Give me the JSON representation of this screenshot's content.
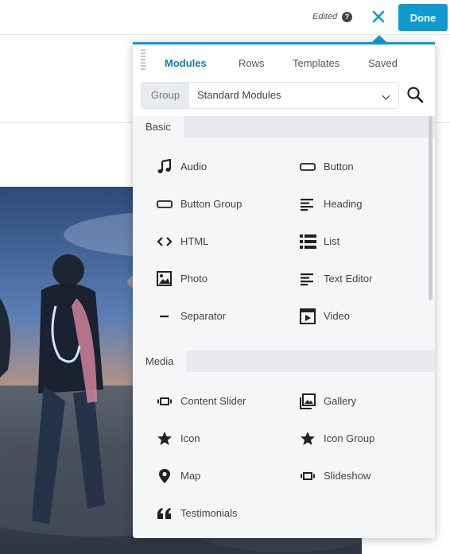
{
  "topbar": {
    "edited_label": "Edited",
    "help_icon": "question-circle-icon",
    "close_icon": "close-x-icon",
    "done_label": "Done",
    "accent": "#0e9bd2"
  },
  "panel": {
    "tabs": [
      {
        "label": "Modules",
        "active": true
      },
      {
        "label": "Rows",
        "active": false
      },
      {
        "label": "Templates",
        "active": false
      },
      {
        "label": "Saved",
        "active": false
      }
    ],
    "filter": {
      "group_label": "Group",
      "selected": "Standard Modules"
    },
    "search_icon": "search-icon",
    "sections": [
      {
        "title": "Basic",
        "items": [
          {
            "label": "Audio",
            "icon": "music-note-icon"
          },
          {
            "label": "Button",
            "icon": "button-icon"
          },
          {
            "label": "Button Group",
            "icon": "button-group-icon"
          },
          {
            "label": "Heading",
            "icon": "heading-icon"
          },
          {
            "label": "HTML",
            "icon": "code-icon"
          },
          {
            "label": "List",
            "icon": "list-icon"
          },
          {
            "label": "Photo",
            "icon": "photo-icon"
          },
          {
            "label": "Text Editor",
            "icon": "text-editor-icon"
          },
          {
            "label": "Separator",
            "icon": "separator-icon"
          },
          {
            "label": "Video",
            "icon": "video-icon"
          }
        ]
      },
      {
        "title": "Media",
        "items": [
          {
            "label": "Content Slider",
            "icon": "slider-icon"
          },
          {
            "label": "Gallery",
            "icon": "gallery-icon"
          },
          {
            "label": "Icon",
            "icon": "star-icon"
          },
          {
            "label": "Icon Group",
            "icon": "star-icon"
          },
          {
            "label": "Map",
            "icon": "map-pin-icon"
          },
          {
            "label": "Slideshow",
            "icon": "slideshow-icon"
          },
          {
            "label": "Testimonials",
            "icon": "quote-icon"
          }
        ]
      }
    ]
  }
}
